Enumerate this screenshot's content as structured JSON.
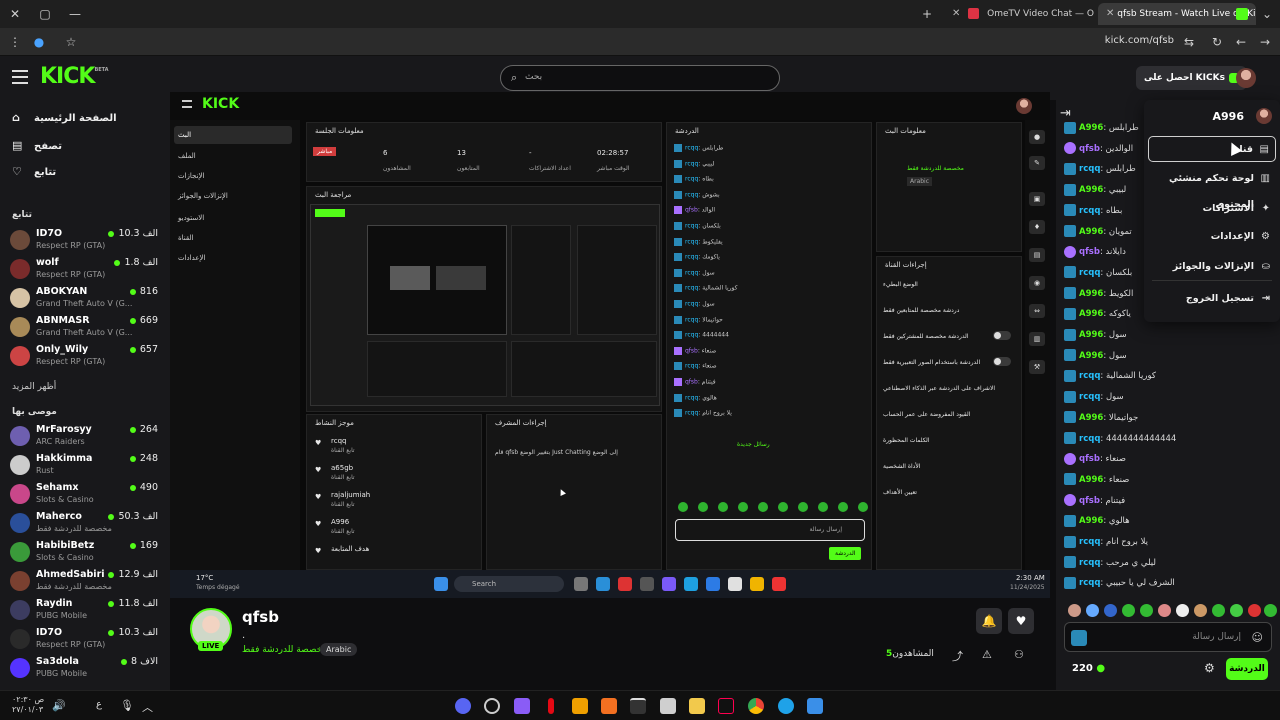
{
  "browser": {
    "tabs": [
      {
        "title": "OmeTV Video Chat — Ome",
        "active": false
      },
      {
        "title": "qfsb Stream - Watch Live on Ki",
        "active": true
      }
    ],
    "url": "kick.com/qfsb"
  },
  "header": {
    "logo": "KICK",
    "logo_badge": "BETA",
    "search_placeholder": "بحث",
    "get_kicks": "احصل على KICKs"
  },
  "sidebar": {
    "nav": [
      {
        "label": "الصفحة الرئيسية",
        "icon": "home-icon"
      },
      {
        "label": "تصفح",
        "icon": "browse-icon"
      },
      {
        "label": "تتابع",
        "icon": "heart-icon"
      }
    ],
    "following_title": "تتابع",
    "following": [
      {
        "name": "ID7O",
        "game": "Respect RP (GTA)",
        "viewers": "10.3 الف"
      },
      {
        "name": "wolf",
        "game": "Respect RP (GTA)",
        "viewers": "1.8 الف"
      },
      {
        "name": "ABOKYAN",
        "game": "Grand Theft Auto V (G...",
        "viewers": "816"
      },
      {
        "name": "ABNMASR",
        "game": "Grand Theft Auto V (G...",
        "viewers": "669"
      },
      {
        "name": "Only_Wily",
        "game": "Respect RP (GTA)",
        "viewers": "657"
      }
    ],
    "show_more": "أظهر المزيد",
    "recommended_title": "موصى بها",
    "recommended": [
      {
        "name": "MrFarosyy",
        "game": "ARC Raiders",
        "viewers": "264"
      },
      {
        "name": "Hakkimma",
        "game": "Rust",
        "viewers": "248"
      },
      {
        "name": "Sehamx",
        "game": "Slots & Casino",
        "viewers": "490"
      },
      {
        "name": "Maherco",
        "game": "مخصصة للدردشة فقط",
        "viewers": "50.3 الف"
      },
      {
        "name": "HabibiBetz",
        "game": "Slots & Casino",
        "viewers": "169"
      },
      {
        "name": "AhmedSabiri",
        "game": "مخصصة للدردشة فقط",
        "viewers": "12.9 الف"
      },
      {
        "name": "Raydin",
        "game": "PUBG Mobile",
        "viewers": "11.8 الف"
      },
      {
        "name": "ID7O",
        "game": "Respect RP (GTA)",
        "viewers": "10.3 الف"
      },
      {
        "name": "Sa3dola",
        "game": "PUBG Mobile",
        "viewers": "8 الاف"
      }
    ]
  },
  "stream_inner": {
    "logo": "KICK",
    "nav": [
      "البث",
      "الملف",
      "الإنجازات",
      "الإنزالات والجوائز",
      "الاستوديو",
      "القناة",
      "الإعدادات"
    ],
    "session_title": "معلومات الجلسة",
    "stats": [
      {
        "value": "02:28:57",
        "label": "الوقت مباشر"
      },
      {
        "value": "-",
        "label": "اعداد الاشتراكات"
      },
      {
        "value": "13",
        "label": "المتابعون"
      },
      {
        "value": "6",
        "label": "المشاهدون"
      }
    ],
    "live_tag": "مباشر",
    "preview_title": "مراجعة البث",
    "chat_title": "الدردشة",
    "stream_info_title": "معلومات البث",
    "stream_info_cat": "مخصصة للدردشة فقط",
    "stream_info_lang": "Arabic",
    "channel_actions_title": "إجراءات القناة",
    "channel_actions": [
      "الوضع البطيء",
      "دردشة مخصصة للمتابعين فقط",
      "الدردشة مخصصة للمشتركين فقط",
      "الدردشة باستخدام الصور التعبيرية فقط",
      "الاشراف على الدردشة عبر الذكاء الاصطناعي",
      "القيود المفروضة على عمر الحساب",
      "الكلمات المحظورة",
      "الأداة الشخصية",
      "تعيين الأهداف"
    ],
    "chat_lines": [
      [
        "rcqq",
        "طرابلس"
      ],
      [
        "rcqq",
        "لبيبي"
      ],
      [
        "rcqq",
        "بطاه"
      ],
      [
        "rcqq",
        "بشوش"
      ],
      [
        "qfsb",
        "الوالد"
      ],
      [
        "rcqq",
        "بلكسان"
      ],
      [
        "rcqq",
        "يفليكوط"
      ],
      [
        "rcqq",
        "ياكومك"
      ],
      [
        "rcqq",
        "سول"
      ],
      [
        "rcqq",
        "كوريا الشمالية"
      ],
      [
        "rcqq",
        "سول"
      ],
      [
        "rcqq",
        "حواتيمالا"
      ],
      [
        "rcqq",
        "4444444"
      ],
      [
        "qfsb",
        "صنعاء"
      ],
      [
        "rcqq",
        "صنعاء"
      ],
      [
        "qfsb",
        "فيتنام"
      ],
      [
        "rcqq",
        "هالوي"
      ],
      [
        "rcqq",
        "يلا بروح انام"
      ]
    ],
    "chat_new": "رسائل جديدة",
    "chat_send": "الدردشة",
    "chat_placeholder": "إرسال رسالة",
    "mod_title": "موجز النشاط",
    "mod_actions_title": "إجراءات المشرف",
    "activity": [
      {
        "name": "rcqq",
        "sub": "تابع القناة"
      },
      {
        "name": "a65gb",
        "sub": "تابع القناة"
      },
      {
        "name": "rajaljumiah",
        "sub": "تابع القناة"
      },
      {
        "name": "A996",
        "sub": "تابع القناة"
      },
      {
        "name": "هدف المتابعة",
        "sub": ""
      }
    ],
    "mod_note": "قام qfsb بتغيير الوضع Just Chatting إلى الوضع",
    "weather": "17°C",
    "weather_sub": "Temps dégagé",
    "taskbar_search": "Search",
    "time": "2:30 AM",
    "date": "11/24/2025"
  },
  "streamer": {
    "name": "qfsb",
    "title": ".",
    "category": "مخصصة للدردشة فقط",
    "language": "Arabic",
    "live_badge": "LIVE",
    "viewers_label": "المشاهدون",
    "viewers_count": "5"
  },
  "chat": {
    "messages": [
      {
        "badge": "bd",
        "user": "A996",
        "cls": "u1",
        "text": "طرابلس"
      },
      {
        "badge": "bdp",
        "user": "qfsb",
        "cls": "u2",
        "text": "الوالدين"
      },
      {
        "badge": "bd",
        "user": "rcqq",
        "cls": "u3",
        "text": "طرابلس"
      },
      {
        "badge": "bd",
        "user": "A996",
        "cls": "u1",
        "text": "لبيبي"
      },
      {
        "badge": "bd",
        "user": "rcqq",
        "cls": "u3",
        "text": "بطاه"
      },
      {
        "badge": "bd",
        "user": "A996",
        "cls": "u1",
        "text": "تمويان"
      },
      {
        "badge": "bdp",
        "user": "qfsb",
        "cls": "u2",
        "text": "دايلاند"
      },
      {
        "badge": "bd",
        "user": "rcqq",
        "cls": "u3",
        "text": "بلكسان"
      },
      {
        "badge": "bd",
        "user": "A996",
        "cls": "u1",
        "text": "الكويط"
      },
      {
        "badge": "bd",
        "user": "A996",
        "cls": "u1",
        "text": "ياكوكه"
      },
      {
        "badge": "bd",
        "user": "A996",
        "cls": "u1",
        "text": "سول"
      },
      {
        "badge": "bd",
        "user": "A996",
        "cls": "u1",
        "text": "سول"
      },
      {
        "badge": "bd",
        "user": "rcqq",
        "cls": "u3",
        "text": "كوريا الشمالية"
      },
      {
        "badge": "bd",
        "user": "rcqq",
        "cls": "u3",
        "text": "سول"
      },
      {
        "badge": "bd",
        "user": "A996",
        "cls": "u1",
        "text": "جواتيمالا"
      },
      {
        "badge": "bd",
        "user": "rcqq",
        "cls": "u3",
        "text": "4444444444444"
      },
      {
        "badge": "bdp",
        "user": "qfsb",
        "cls": "u2",
        "text": "صنعاء"
      },
      {
        "badge": "bd",
        "user": "A996",
        "cls": "u1",
        "text": "صنعاء"
      },
      {
        "badge": "bdp",
        "user": "qfsb",
        "cls": "u2",
        "text": "فيتنام"
      },
      {
        "badge": "bd",
        "user": "A996",
        "cls": "u1",
        "text": "هالوي"
      },
      {
        "badge": "bd",
        "user": "rcqq",
        "cls": "u3",
        "text": "يلا بروح انام"
      },
      {
        "badge": "bd",
        "user": "rcqq",
        "cls": "u3",
        "text": "ليلي ي مرحب"
      },
      {
        "badge": "bd",
        "user": "rcqq",
        "cls": "u3",
        "text": "الشرف لي يا حبيبي"
      }
    ],
    "input_placeholder": "إرسال رسالة",
    "kicks_balance": "220",
    "send_label": "الدردشة"
  },
  "dropdown": {
    "username": "A996",
    "items": [
      {
        "label": "قناة",
        "icon": "channel-icon",
        "selected": true
      },
      {
        "label": "لوحة تحكم منشئي المحتوى",
        "icon": "dashboard-icon",
        "selected": false
      },
      {
        "label": "الاشتراكات",
        "icon": "sparkle-icon",
        "selected": false
      },
      {
        "label": "الإعدادات",
        "icon": "gear-icon",
        "selected": false
      },
      {
        "label": "الإنزالات والجوائز",
        "icon": "drops-icon",
        "selected": false
      },
      {
        "label": "تسجيل الخروج",
        "icon": "logout-icon",
        "selected": false
      }
    ]
  },
  "os": {
    "clock_time": "۰۲:۳۰ ص",
    "clock_date": "۲۷/۰۱/۰۳",
    "lang": "ع"
  },
  "colors": {
    "accent": "#53fc18",
    "background": "#0e0e10",
    "panel": "#18181b"
  }
}
